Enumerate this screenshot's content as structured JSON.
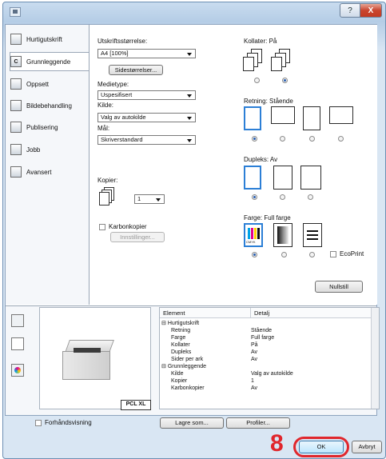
{
  "titlebar": {
    "help_label": "?",
    "close_label": "X"
  },
  "nav": {
    "items": [
      {
        "label": "Hurtigutskrift",
        "icon": "quick-print-icon"
      },
      {
        "label": "Grunnleggende",
        "icon": "basic-icon",
        "icon_text": "C",
        "selected": true
      },
      {
        "label": "Oppsett",
        "icon": "layout-icon"
      },
      {
        "label": "Bildebehandling",
        "icon": "imaging-icon"
      },
      {
        "label": "Publisering",
        "icon": "publishing-icon"
      },
      {
        "label": "Jobb",
        "icon": "job-icon"
      },
      {
        "label": "Avansert",
        "icon": "advanced-icon"
      }
    ]
  },
  "basic": {
    "print_size_label": "Utskriftsstørrelse:",
    "print_size_value": "A4  [100%]",
    "page_sizes_button": "Sidestørrelser...",
    "media_type_label": "Medietype:",
    "media_type_value": "Uspesifisert",
    "source_label": "Kilde:",
    "source_value": "Valg av autokilde",
    "destination_label": "Mål:",
    "destination_value": "Skriverstandard",
    "copies_label": "Kopier:",
    "copies_value": "1",
    "carbon_copies_label": "Karbonkopier",
    "settings_button": "Innstillinger..."
  },
  "right": {
    "collate_label": "Kollater:  På",
    "orientation_label": "Retning:  Stående",
    "duplex_label": "Dupleks:  Av",
    "color_label": "Farge:  Full farge",
    "ecoprint_label": "EcoPrint",
    "reset_button": "Nullstill",
    "cmyk_text": "CMYK"
  },
  "preview": {
    "pcl_label": "PCL XL"
  },
  "table": {
    "headers": [
      "Element",
      "Detalj"
    ],
    "rows": [
      {
        "k": "Hurtigutskrift",
        "v": "",
        "group": true
      },
      {
        "k": "Retning",
        "v": "Stående"
      },
      {
        "k": "Farge",
        "v": "Full farge"
      },
      {
        "k": "Kollater",
        "v": "På"
      },
      {
        "k": "Dupleks",
        "v": "Av"
      },
      {
        "k": "Sider per ark",
        "v": "Av"
      },
      {
        "k": "Grunnleggende",
        "v": "",
        "group": true
      },
      {
        "k": "Kilde",
        "v": "Valg av autokilde"
      },
      {
        "k": "Kopier",
        "v": "1"
      },
      {
        "k": "Karbonkopier",
        "v": "Av"
      }
    ]
  },
  "footer": {
    "preview_label": "Forhåndsvisning",
    "save_as_button": "Lagre som...",
    "profiles_button": "Profiler...",
    "ok_button": "OK",
    "cancel_button": "Avbryt",
    "step_number": "8"
  },
  "colors": {
    "accent": "#2c7fd6",
    "callout": "#e0262c"
  }
}
